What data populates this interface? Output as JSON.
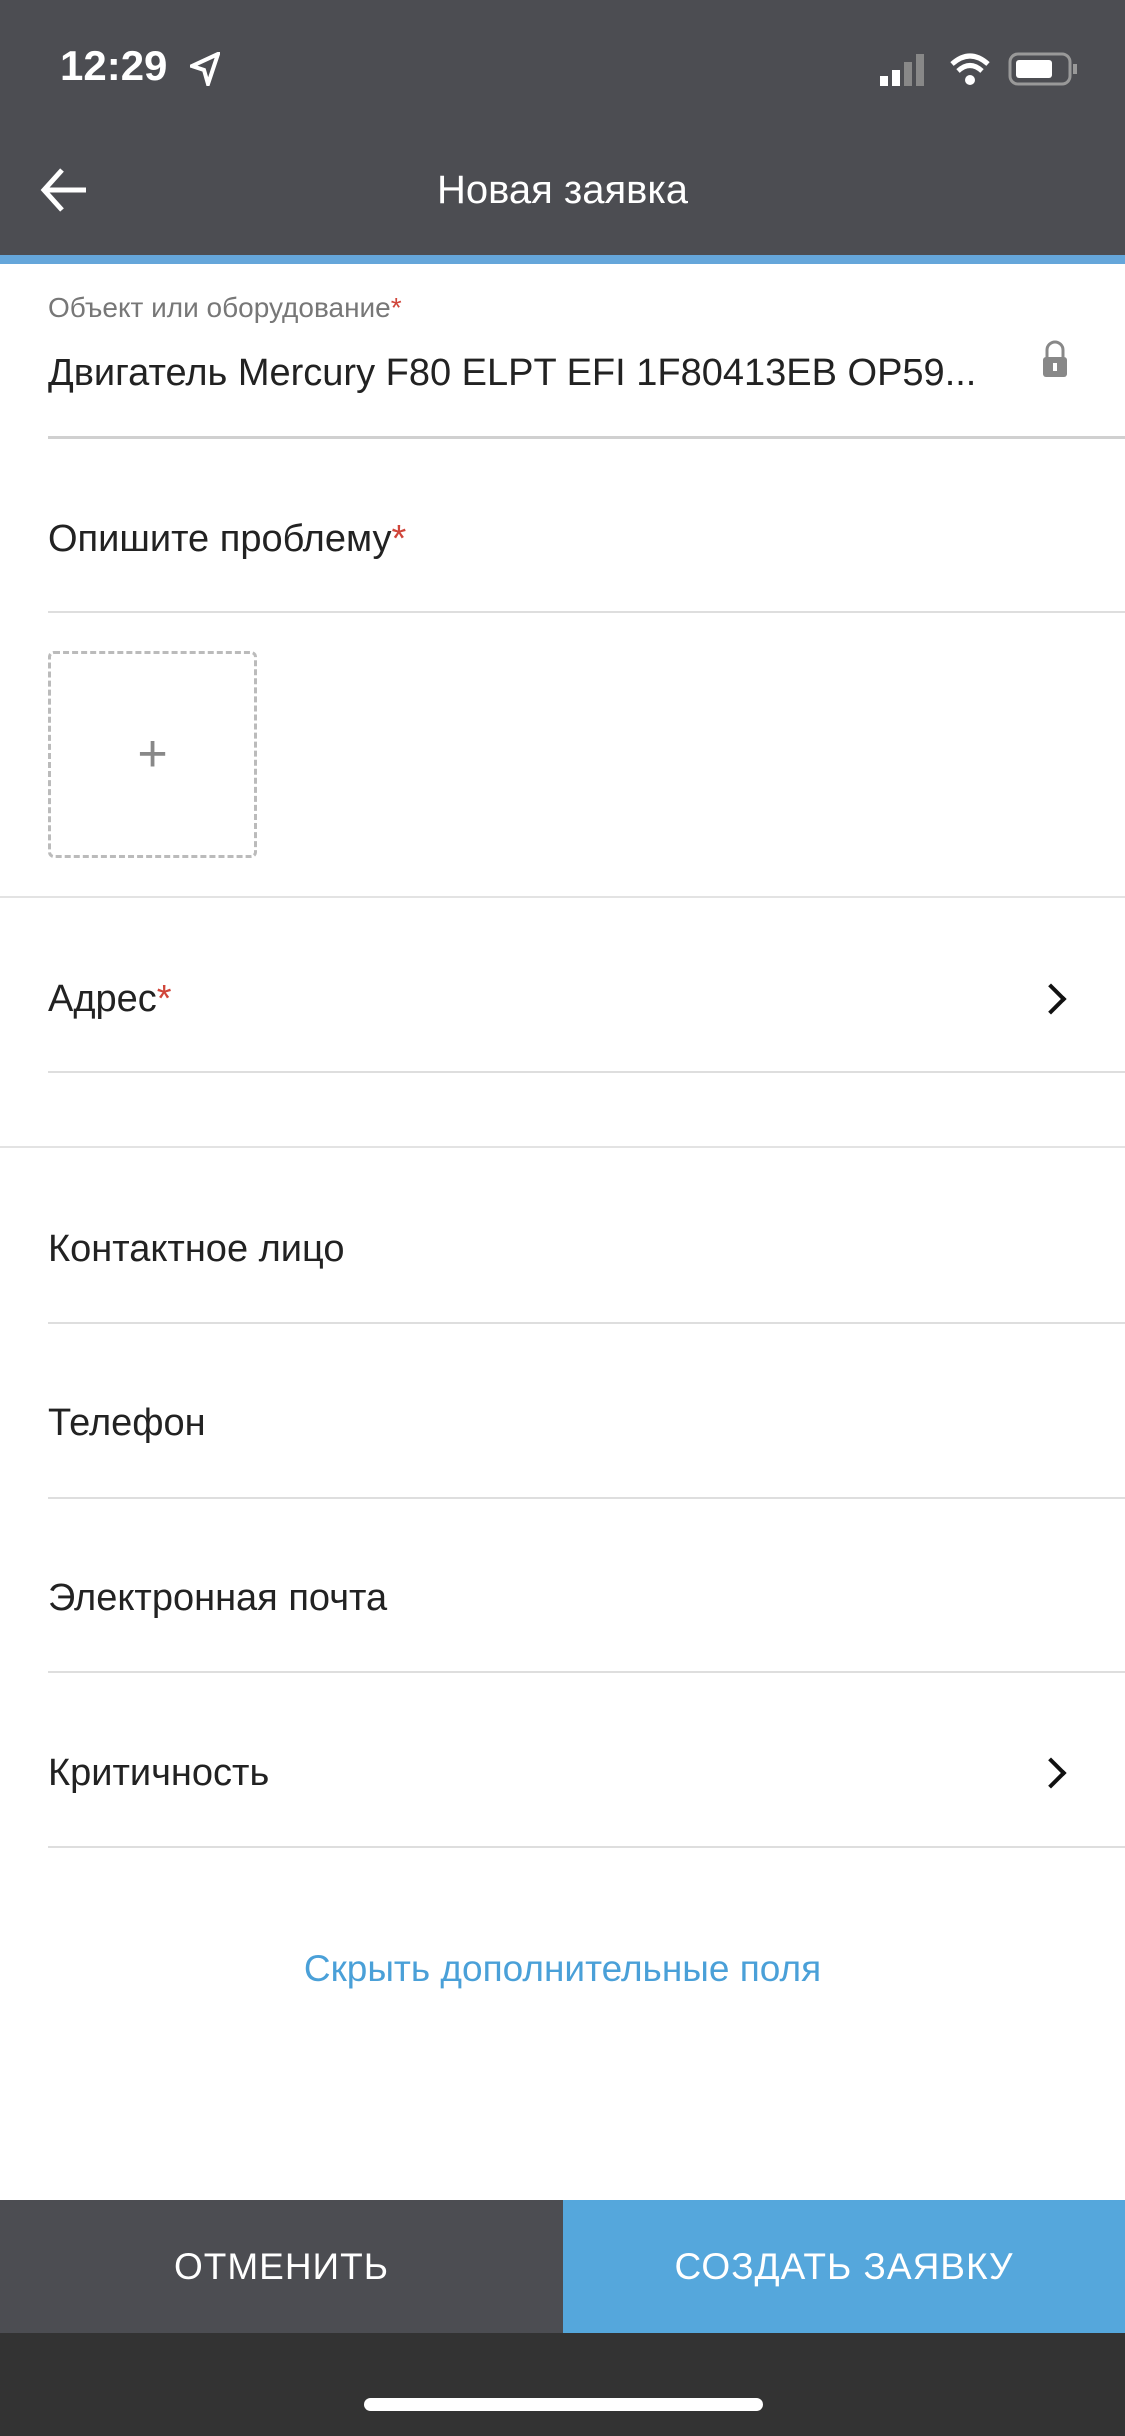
{
  "status_bar": {
    "time": "12:29"
  },
  "header": {
    "title": "Новая заявка"
  },
  "form": {
    "object_label": "Объект или оборудование",
    "required_mark": "*",
    "object_value": "Двигатель Mercury F80 ELPT EFI 1F80413EB OP59...",
    "problem_placeholder": "Опишите проблему",
    "add_photo": "+",
    "address": "Адрес",
    "contact": "Контактное лицо",
    "phone": "Телефон",
    "email": "Электронная почта",
    "criticality": "Критичность",
    "hide_fields_link": "Скрыть дополнительные поля"
  },
  "footer": {
    "cancel": "ОТМЕНИТЬ",
    "create": "СОЗДАТЬ ЗАЯВКУ"
  },
  "colors": {
    "header": "#4c4d52",
    "accent": "#65a6da",
    "create_button": "#55a7dc",
    "required": "#d0453a"
  }
}
